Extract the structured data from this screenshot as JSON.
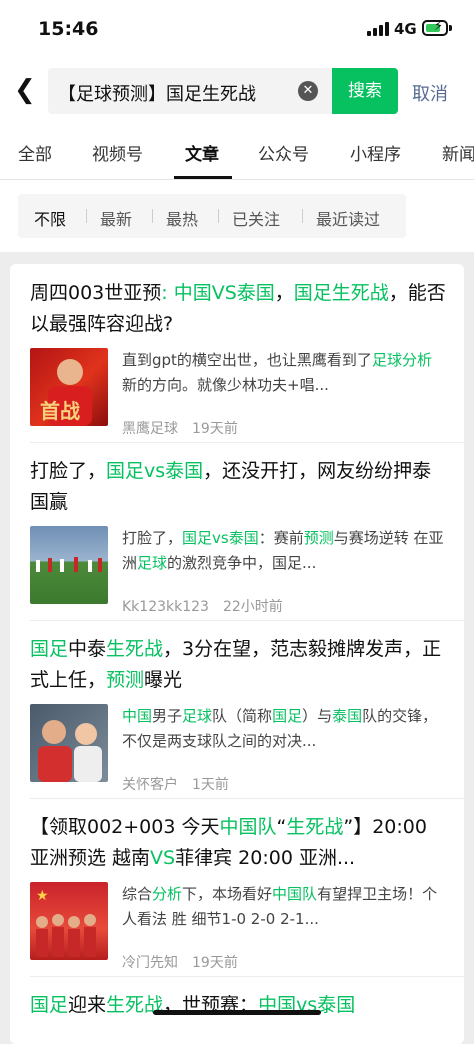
{
  "status": {
    "time": "15:46",
    "network": "4G"
  },
  "search": {
    "query": "【足球预测】国足生死战",
    "button": "搜索",
    "cancel": "取消"
  },
  "tabs": [
    "全部",
    "视频号",
    "文章",
    "公众号",
    "小程序",
    "新闻"
  ],
  "active_tab": "文章",
  "filters": [
    "不限",
    "最新",
    "最热",
    "已关注",
    "最近读过"
  ],
  "active_filter": "不限",
  "colors": {
    "accent": "#07c160",
    "link": "#576b95"
  },
  "articles": [
    {
      "title": [
        [
          "周四003世亚预",
          0
        ],
        [
          ": 中国VS泰国",
          1
        ],
        [
          "，",
          0
        ],
        [
          "国足生死战",
          1
        ],
        [
          "，能否以最强阵容迎战?",
          0
        ]
      ],
      "snippet": [
        [
          "直到gpt的横空出世，也让黑鹰看到了",
          0
        ],
        [
          "足球分析",
          1
        ],
        [
          "新的方向。就像少林功夫+唱...",
          0
        ]
      ],
      "source": "黑鹰足球",
      "time": "19天前"
    },
    {
      "title": [
        [
          "打脸了，",
          0
        ],
        [
          "国足vs泰国",
          1
        ],
        [
          "，还没开打，网友纷纷押泰国赢",
          0
        ]
      ],
      "snippet": [
        [
          "打脸了，",
          0
        ],
        [
          "国足vs泰国",
          1
        ],
        [
          "：赛前",
          0
        ],
        [
          "预测",
          1
        ],
        [
          "与赛场逆转 在亚洲",
          0
        ],
        [
          "足球",
          1
        ],
        [
          "的激烈竞争中，国足...",
          0
        ]
      ],
      "source": "Kk123kk123",
      "time": "22小时前"
    },
    {
      "title": [
        [
          "国足",
          1
        ],
        [
          "中泰",
          0
        ],
        [
          "生死战",
          1
        ],
        [
          "，3分在望，范志毅摊牌发声，正式上任，",
          0
        ],
        [
          "预测",
          1
        ],
        [
          "曝光",
          0
        ]
      ],
      "snippet": [
        [
          "中国",
          1
        ],
        [
          "男子",
          0
        ],
        [
          "足球",
          1
        ],
        [
          "队（简称",
          0
        ],
        [
          "国足",
          1
        ],
        [
          "）与",
          0
        ],
        [
          "泰国",
          1
        ],
        [
          "队的交锋，不仅是两支球队之间的对决...",
          0
        ]
      ],
      "source": "关怀客户",
      "time": "1天前"
    },
    {
      "title": [
        [
          "【领取002+003 今天",
          0
        ],
        [
          "中国队",
          1
        ],
        [
          "“",
          0
        ],
        [
          "生死战",
          1
        ],
        [
          "”】20:00 亚洲预选 越南",
          0
        ],
        [
          "VS",
          1
        ],
        [
          "菲律宾 20:00 亚洲...",
          0
        ]
      ],
      "snippet": [
        [
          "综合",
          0
        ],
        [
          "分析",
          1
        ],
        [
          "下，本场看好",
          0
        ],
        [
          "中国队",
          1
        ],
        [
          "有望捍卫主场！个人看法 胜 细节1-0 2-0 2-1...",
          0
        ]
      ],
      "source": "冷门先知",
      "time": "19天前"
    },
    {
      "title": [
        [
          "国足",
          1
        ],
        [
          "迎来",
          0
        ],
        [
          "生死战",
          1
        ],
        [
          "，世预赛：",
          0
        ],
        [
          "中国vs泰国",
          1
        ]
      ],
      "snippet": [],
      "source": "",
      "time": ""
    }
  ]
}
